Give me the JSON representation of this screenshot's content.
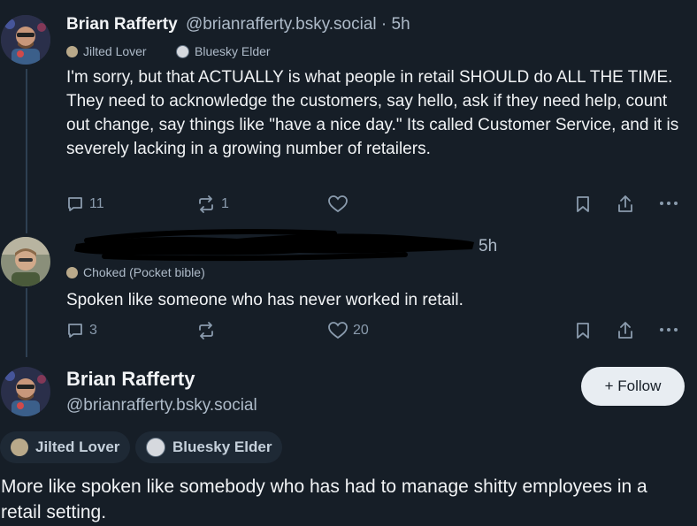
{
  "post1": {
    "author_name": "Brian Rafferty",
    "handle_time": "@brianrafferty.bsky.social · 5h",
    "badges": [
      "Jilted Lover",
      "Bluesky Elder"
    ],
    "text": "I'm sorry, but that ACTUALLY is what people in retail SHOULD do ALL THE TIME. They need to acknowledge the customers, say hello, ask if they need help, count out change, say things like \"have a nice day.\" Its called Customer Service, and it is severely lacking in a growing number of retailers.",
    "reply_count": "11",
    "repost_count": "1",
    "like_count": ""
  },
  "post2": {
    "time": "5h",
    "badge": "Choked (Pocket bible)",
    "text": "Spoken like someone who has never worked in retail.",
    "reply_count": "3",
    "repost_count": "",
    "like_count": "20"
  },
  "main_post": {
    "author_name": "Brian Rafferty",
    "handle": "@brianrafferty.bsky.social",
    "follow_label": "+ Follow",
    "badges": [
      "Jilted Lover",
      "Bluesky Elder"
    ],
    "text": "More like spoken like somebody who has had to manage shitty employees in a retail setting."
  },
  "colors": {
    "background": "#161e27",
    "text": "#f1f3f5",
    "muted": "#aebbc9",
    "icon": "#8a9bad",
    "thread_line": "#2e4052",
    "pill_bg": "#1e2935",
    "follow_bg": "#e8edf2"
  }
}
